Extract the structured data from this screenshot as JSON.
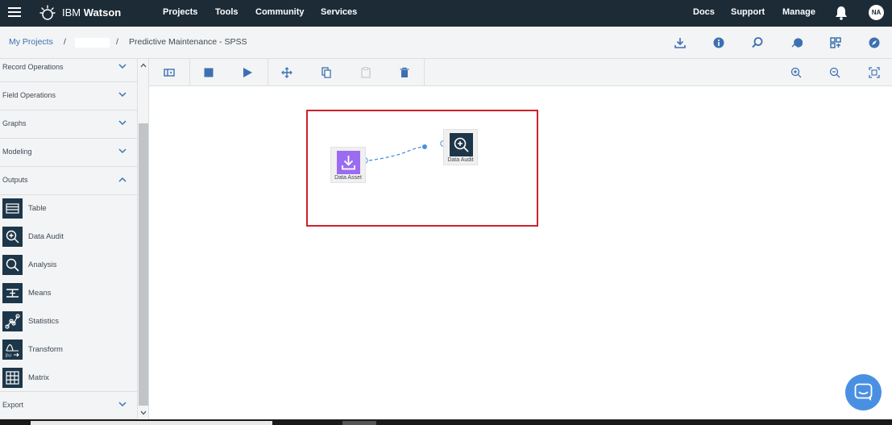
{
  "topnav": {
    "brand_light": "IBM",
    "brand_bold": "Watson",
    "links": [
      "Projects",
      "Tools",
      "Community",
      "Services"
    ],
    "right_links": [
      "Docs",
      "Support",
      "Manage"
    ],
    "avatar_initials": "NA"
  },
  "breadcrumb": {
    "root": "My Projects",
    "sep": "/",
    "current": "Predictive Maintenance - SPSS"
  },
  "sidebar": {
    "sections_top": [
      {
        "label": "Record Operations",
        "state": "collapsed"
      },
      {
        "label": "Field Operations",
        "state": "collapsed"
      },
      {
        "label": "Graphs",
        "state": "collapsed"
      },
      {
        "label": "Modeling",
        "state": "collapsed"
      },
      {
        "label": "Outputs",
        "state": "expanded"
      }
    ],
    "output_nodes": [
      {
        "label": "Table",
        "icon": "table-icon"
      },
      {
        "label": "Data Audit",
        "icon": "zoom-in-icon"
      },
      {
        "label": "Analysis",
        "icon": "search-icon"
      },
      {
        "label": "Means",
        "icon": "means-icon"
      },
      {
        "label": "Statistics",
        "icon": "statistics-icon"
      },
      {
        "label": "Transform",
        "icon": "transform-icon"
      },
      {
        "label": "Matrix",
        "icon": "matrix-icon"
      }
    ],
    "section_bottom": {
      "label": "Export",
      "state": "collapsed"
    }
  },
  "canvas": {
    "nodes": [
      {
        "label": "Data Asset",
        "icon": "download-icon",
        "color": "#9b6cf0"
      },
      {
        "label": "Data Audit",
        "icon": "zoom-in-icon",
        "color": "#1d3649"
      }
    ]
  },
  "colors": {
    "nav_bg": "#1c2b36",
    "accent": "#3d70b2",
    "highlight_box": "#d0202a"
  }
}
